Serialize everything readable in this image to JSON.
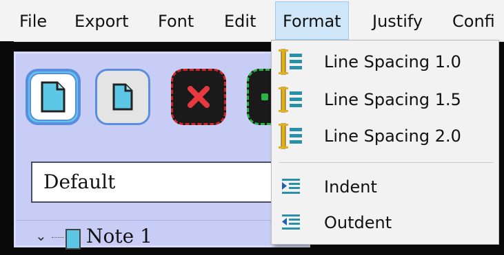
{
  "menubar": {
    "items": [
      "File",
      "Export",
      "Font",
      "Edit",
      "Format",
      "Justify",
      "Confi"
    ],
    "active": "Format"
  },
  "toolbar": {
    "buttons": [
      {
        "name": "new-note-button",
        "icon": "document-icon"
      },
      {
        "name": "open-note-button",
        "icon": "document-icon"
      },
      {
        "name": "delete-button",
        "icon": "red-x-icon"
      },
      {
        "name": "green-button",
        "icon": "green-icon"
      }
    ]
  },
  "style_select": {
    "value": "Default"
  },
  "tree": {
    "items": [
      {
        "label": "Note 1",
        "expanded": true
      }
    ]
  },
  "format_menu": {
    "items": [
      {
        "label": "Line Spacing 1.0",
        "icon": "line-spacing-icon"
      },
      {
        "label": "Line Spacing 1.5",
        "icon": "line-spacing-icon"
      },
      {
        "label": "Line Spacing 2.0",
        "icon": "line-spacing-icon"
      },
      {
        "label": "Indent",
        "icon": "indent-icon"
      },
      {
        "label": "Outdent",
        "icon": "outdent-icon"
      }
    ]
  },
  "colors": {
    "menu_highlight": "#cfe6f8",
    "panel_bg": "#c7cdf5",
    "doc_cyan": "#5cc8e6",
    "accent_blue": "#5a8de0",
    "delete_red": "#d4262b",
    "icon_gold": "#e0b020",
    "icon_teal": "#2a8fa8"
  }
}
